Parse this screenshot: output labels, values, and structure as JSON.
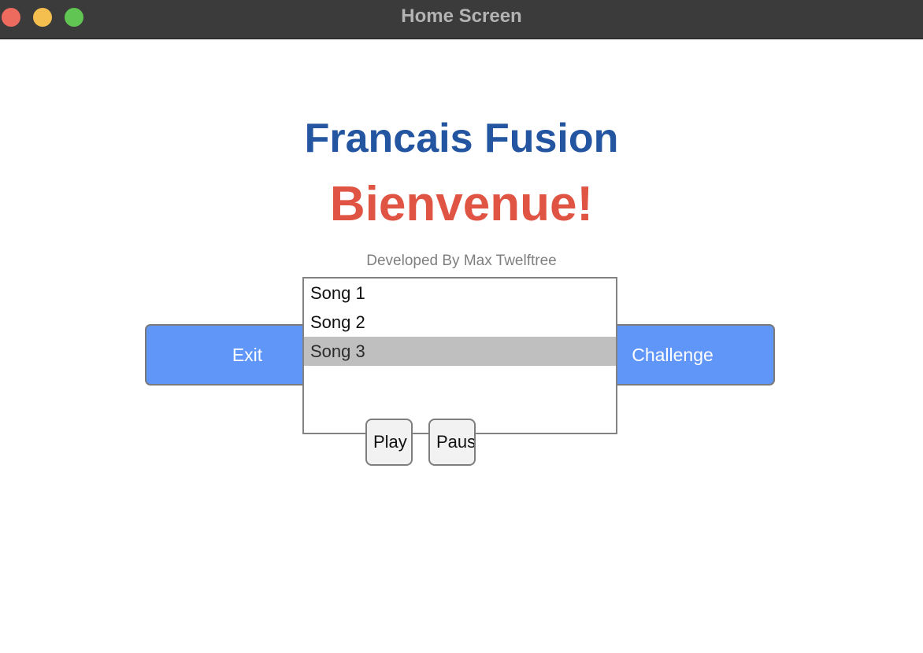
{
  "window": {
    "title": "Home Screen"
  },
  "header": {
    "app_title": "Francais Fusion",
    "welcome": "Bienvenue!",
    "credit": "Developed By Max Twelftree"
  },
  "buttons": {
    "exit_label": "Exit",
    "challenge_label": "Challenge",
    "play_label": "Play",
    "pause_label": "Pause"
  },
  "song_list": {
    "items": [
      {
        "label": "Song 1",
        "selected": false
      },
      {
        "label": "Song 2",
        "selected": false
      },
      {
        "label": "Song 3",
        "selected": true
      }
    ]
  },
  "colors": {
    "titlebar": "#3b3b3b",
    "app_title": "#2355a0",
    "welcome": "#e05444",
    "primary_button": "#6096f7",
    "selection": "#bfbfbf",
    "traffic_close": "#ed6a5e",
    "traffic_min": "#f5bf4f",
    "traffic_max": "#61c554"
  }
}
